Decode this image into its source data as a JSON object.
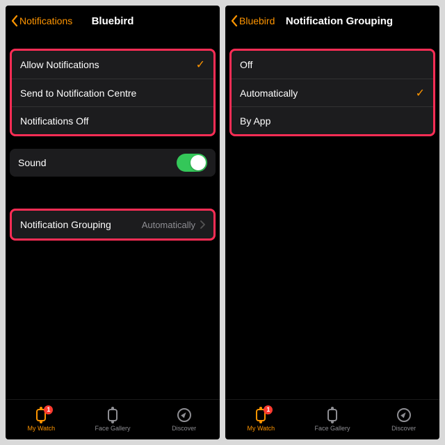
{
  "left": {
    "back_label": "Notifications",
    "title": "Bluebird",
    "options": [
      {
        "label": "Allow Notifications",
        "checked": true
      },
      {
        "label": "Send to Notification Centre",
        "checked": false
      },
      {
        "label": "Notifications Off",
        "checked": false
      }
    ],
    "sound_label": "Sound",
    "sound_on": true,
    "grouping_label": "Notification Grouping",
    "grouping_value": "Automatically"
  },
  "right": {
    "back_label": "Bluebird",
    "title": "Notification Grouping",
    "options": [
      {
        "label": "Off",
        "checked": false
      },
      {
        "label": "Automatically",
        "checked": true
      },
      {
        "label": "By App",
        "checked": false
      }
    ]
  },
  "tabs": {
    "my_watch": "My Watch",
    "face_gallery": "Face Gallery",
    "discover": "Discover",
    "badge": "1"
  },
  "colors": {
    "accent": "#ff9500",
    "toggle_on": "#34c759",
    "highlight": "#ff2d55"
  }
}
